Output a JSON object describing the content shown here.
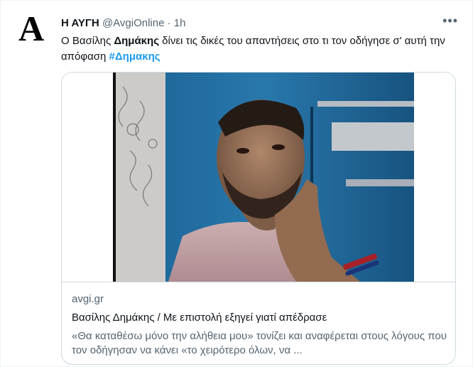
{
  "tweet": {
    "avatar_letter": "A",
    "name": "Η ΑΥΓΗ",
    "handle": "@AvgiOnline",
    "separator": "·",
    "time": "1h",
    "more_icon": "more-dots-icon",
    "text_prefix": "Ο Βασίλης ",
    "text_bold": "Δημάκης",
    "text_rest": " δίνει τις δικές του απαντήσεις στο τι τον οδήγησε σ' αυτή την απόφαση ",
    "hashtag": "#Δημακης"
  },
  "card": {
    "domain": "avgi.gr",
    "title": "Βασίλης Δημάκης / Με επιστολή εξηγεί γιατί απέδρασε",
    "description": "«Θα καταθέσω μόνο την αλήθεια μου» τονίζει και αναφέρεται στους λόγους που τον οδήγησαν να κάνει «το χειρότερο όλων, να ..."
  },
  "colors": {
    "hashtag": "#1d9bf0",
    "secondary_text": "#536471",
    "border": "#cfd9de"
  }
}
